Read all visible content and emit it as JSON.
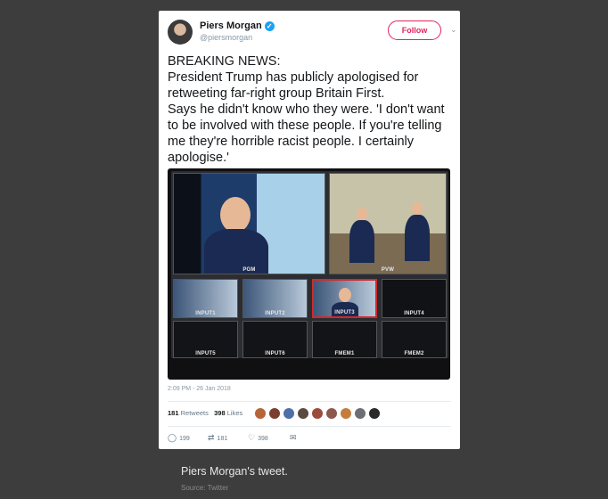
{
  "tweet": {
    "name": "Piers Morgan",
    "handle": "@piersmorgan",
    "follow_label": "Follow",
    "text": "BREAKING NEWS:\nPresident Trump has publicly apologised for retweeting far-right group Britain First.\nSays he didn't know who they were. 'I don't want to be involved with these people. If you're telling me they're horrible racist people. I certainly apologise.'",
    "image": {
      "labels": [
        "PGM",
        "PVW",
        "INPUT1",
        "INPUT2",
        "INPUT3",
        "INPUT4",
        "INPUT5",
        "INPUT6",
        "FMEM1",
        "FMEM2"
      ]
    },
    "timestamp": "2:09 PM - 26 Jan 2018",
    "retweets_count": "181",
    "retweets_label": "Retweets",
    "likes_count": "398",
    "likes_label": "Likes",
    "actions": {
      "replies": "199",
      "retweets": "181",
      "likes": "398"
    }
  },
  "caption": {
    "title": "Piers Morgan's tweet.",
    "source": "Source: Twitter"
  },
  "colors": {
    "background": "#3d3d3d",
    "follow": "#e0245e",
    "verified": "#1da1f2"
  }
}
